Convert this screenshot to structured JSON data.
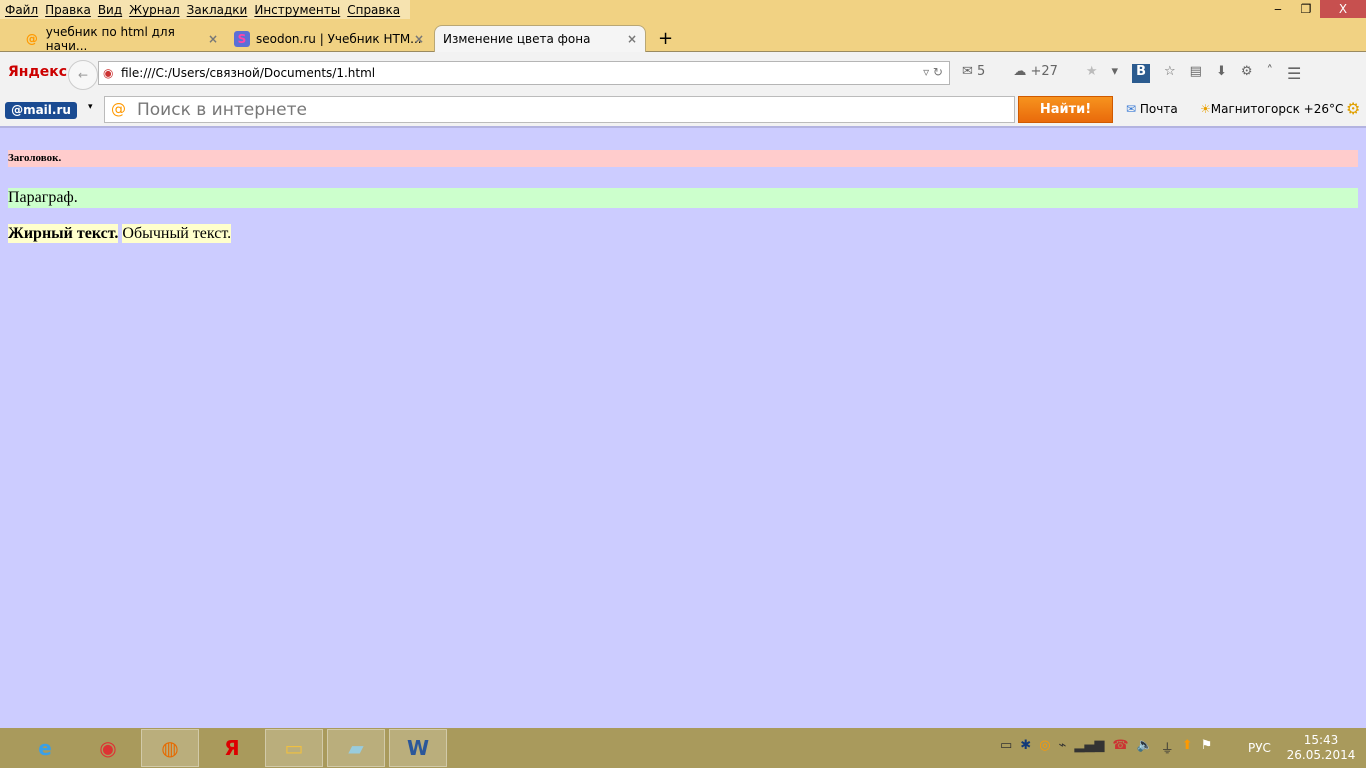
{
  "menu": [
    "Файл",
    "Правка",
    "Вид",
    "Журнал",
    "Закладки",
    "Инструменты",
    "Справка"
  ],
  "window": {
    "minimize": "‒",
    "restore": "❐",
    "close": "X"
  },
  "tabs": [
    {
      "label": "учебник по html для начи...",
      "close": "×"
    },
    {
      "label": "seodon.ru | Учебник HTM...",
      "close": "×"
    },
    {
      "label": "Изменение цвета фона",
      "close": "×"
    }
  ],
  "new_tab": "+",
  "nav": {
    "yandex": "Яндекс",
    "url": "file:///C:/Users/связной/Documents/1.html",
    "mail_count": "5",
    "weather": "+27"
  },
  "mailbar": {
    "logo": "@mail.ru",
    "search_placeholder": "Поиск в интернете",
    "find": "Найти!",
    "pochta": "Почта",
    "weather": "Магнитогорск +26°C"
  },
  "page": {
    "heading": "Заголовок.",
    "paragraph": "Параграф.",
    "bold": "Жирный текст.",
    "normal": "Обычный текст."
  },
  "taskbar": {
    "lang": "РУС",
    "time": "15:43",
    "date": "26.05.2014"
  },
  "colors": {
    "page_bg": "#ccccff",
    "heading_bg": "#ffcccc",
    "paragraph_bg": "#ccffcc",
    "span_bg": "#ffffcc"
  }
}
